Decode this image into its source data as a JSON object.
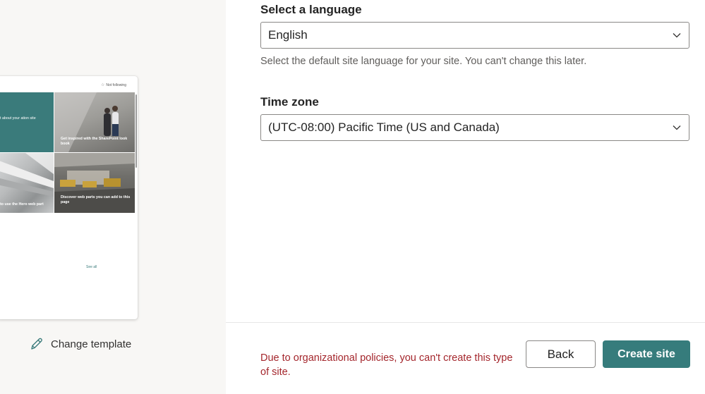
{
  "preview": {
    "follow_label": "Not following",
    "tiles": [
      {
        "caption": "t about your ation site"
      },
      {
        "caption": "Get inspired with the SharePoint look book"
      },
      {
        "caption": "to use the Hero web part"
      },
      {
        "caption": "Discover web parts you can add to this page"
      }
    ],
    "see_all": "See all"
  },
  "change_template": {
    "label": "Change template",
    "icon": "pencil-icon"
  },
  "language": {
    "label": "Select a language",
    "value": "English",
    "helper": "Select the default site language for your site. You can't change this later."
  },
  "timezone": {
    "label": "Time zone",
    "value": "(UTC-08:00) Pacific Time (US and Canada)"
  },
  "footer": {
    "error": "Due to organizational policies, you can't create this type of site.",
    "back_label": "Back",
    "create_label": "Create site"
  },
  "colors": {
    "accent": "#367c7c",
    "error": "#a4262c"
  }
}
